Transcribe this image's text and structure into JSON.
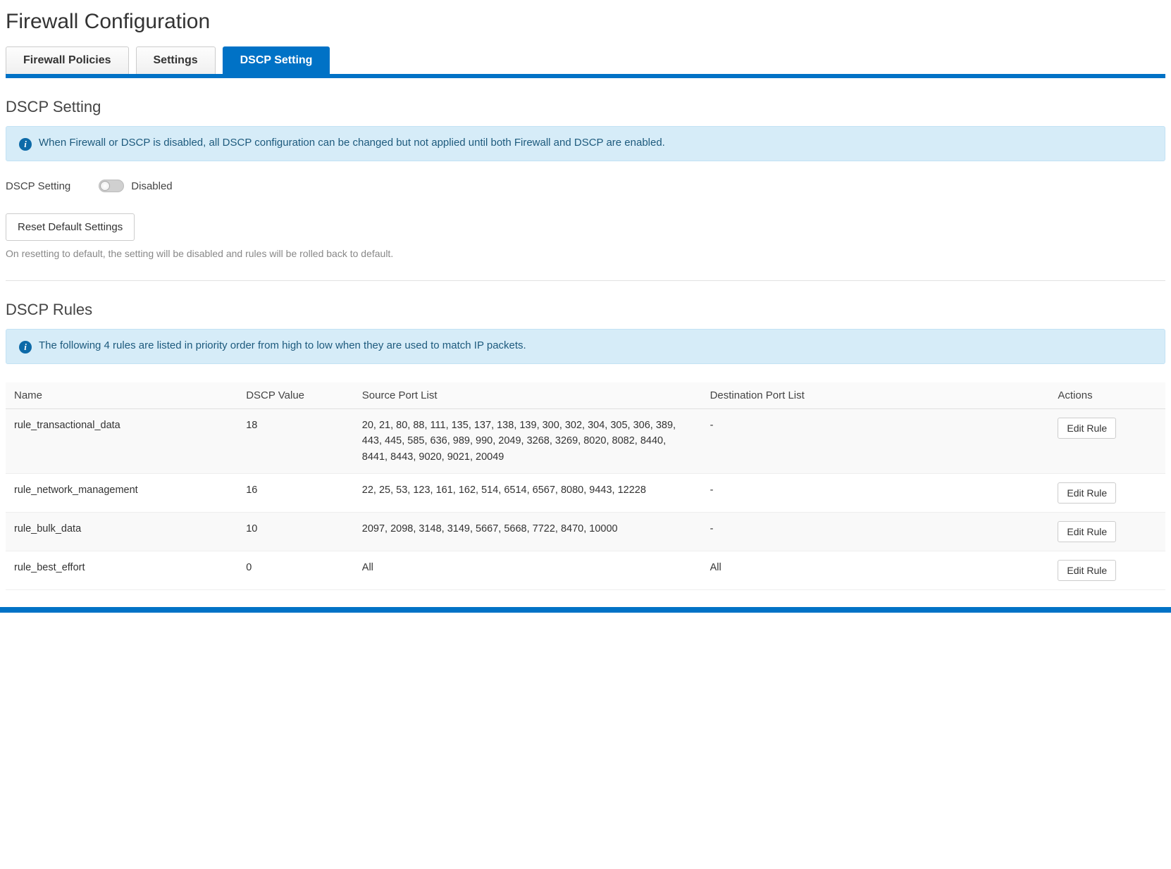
{
  "page_title": "Firewall Configuration",
  "tabs": [
    {
      "label": "Firewall Policies",
      "active": false
    },
    {
      "label": "Settings",
      "active": false
    },
    {
      "label": "DSCP Setting",
      "active": true
    }
  ],
  "section_setting": {
    "heading": "DSCP Setting",
    "info": "When Firewall or DSCP is disabled, all DSCP configuration can be changed but not applied until both Firewall and DSCP are enabled.",
    "toggle_label": "DSCP Setting",
    "toggle_state": "Disabled",
    "reset_button": "Reset Default Settings",
    "reset_help": "On resetting to default, the setting will be disabled and rules will be rolled back to default."
  },
  "section_rules": {
    "heading": "DSCP Rules",
    "info": "The following 4 rules are listed in priority order from high to low when they are used to match IP packets.",
    "columns": {
      "name": "Name",
      "dscp": "DSCP Value",
      "src": "Source Port List",
      "dst": "Destination Port List",
      "actions": "Actions"
    },
    "edit_label": "Edit Rule",
    "rows": [
      {
        "name": "rule_transactional_data",
        "dscp": "18",
        "src": "20, 21, 80, 88, 111, 135, 137, 138, 139, 300, 302, 304, 305, 306, 389, 443, 445, 585, 636, 989, 990, 2049, 3268, 3269, 8020, 8082, 8440, 8441, 8443, 9020, 9021, 20049",
        "dst": "-"
      },
      {
        "name": "rule_network_management",
        "dscp": "16",
        "src": "22, 25, 53, 123, 161, 162, 514, 6514, 6567, 8080, 9443, 12228",
        "dst": "-"
      },
      {
        "name": "rule_bulk_data",
        "dscp": "10",
        "src": "2097, 2098, 3148, 3149, 5667, 5668, 7722, 8470, 10000",
        "dst": "-"
      },
      {
        "name": "rule_best_effort",
        "dscp": "0",
        "src": "All",
        "dst": "All"
      }
    ]
  }
}
